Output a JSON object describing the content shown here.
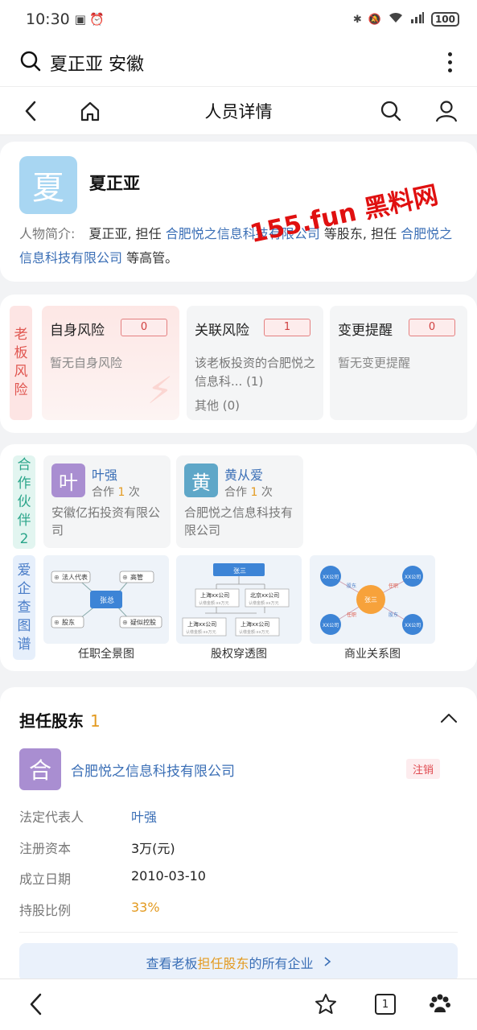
{
  "status": {
    "time": "10:30",
    "battery": "100"
  },
  "search": {
    "query": "夏正亚 安徽"
  },
  "nav": {
    "title": "人员详情"
  },
  "profile": {
    "avatar_char": "夏",
    "name": "夏正亚",
    "bio_label": "人物简介:",
    "bio_part1": "夏正亚, 担任",
    "bio_company1": "合肥悦之信息科技有限公司",
    "bio_part2": "等股东, 担任",
    "bio_company2": "合肥悦之信息科技有限公司",
    "bio_part3": "等高管。"
  },
  "watermark": "155.fun 黑料网",
  "risk": {
    "tag_chars": [
      "老",
      "板",
      "风",
      "险"
    ],
    "boxes": [
      {
        "title": "自身风险",
        "count": "0",
        "desc": "暂无自身风险"
      },
      {
        "title": "关联风险",
        "count": "1",
        "desc": "该老板投资的合肥悦之信息科... (1)",
        "extra": "其他 (0)"
      },
      {
        "title": "变更提醒",
        "count": "0",
        "desc": "暂无变更提醒"
      }
    ]
  },
  "partners": {
    "tag_chars": [
      "合",
      "作",
      "伙",
      "伴",
      "2"
    ],
    "items": [
      {
        "avatar_char": "叶",
        "name": "叶强",
        "coop_prefix": "合作",
        "coop_count": "1",
        "coop_suffix": "次",
        "company": "安徽亿拓投资有限公司",
        "color": "#a98ed1"
      },
      {
        "avatar_char": "黄",
        "name": "黄从爱",
        "coop_prefix": "合作",
        "coop_count": "1",
        "coop_suffix": "次",
        "company": "合肥悦之信息科技有限公司",
        "color": "#5fa7c8"
      }
    ]
  },
  "graphs": {
    "tag_chars": [
      "爱",
      "企",
      "查",
      "图",
      "谱"
    ],
    "items": [
      {
        "caption": "任职全景图",
        "center": "张总",
        "labels": [
          "法人代表",
          "高管",
          "股东",
          "疑似控股"
        ]
      },
      {
        "caption": "股权穿透图",
        "top": "张三",
        "labels": [
          "上海xx公司",
          "北京xx公司",
          "上海xx公司",
          "上海xx公司"
        ],
        "sub": "认缴金额:xx万元"
      },
      {
        "caption": "商业关系图",
        "center": "张三",
        "nodes": [
          "XX公司",
          "XX公司",
          "XX公司",
          "XX公司"
        ],
        "edges": [
          "股东",
          "任职",
          "任职",
          "股东"
        ]
      }
    ]
  },
  "holder": {
    "title": "担任股东",
    "count": "1",
    "company_char": "合",
    "company": "合肥悦之信息科技有限公司",
    "status_tag": "注销",
    "rows": [
      {
        "key": "法定代表人",
        "value": "叶强"
      },
      {
        "key": "注册资本",
        "value": "3万(元)"
      },
      {
        "key": "成立日期",
        "value": "2010-03-10"
      },
      {
        "key": "持股比例",
        "value": "33%"
      }
    ],
    "view_prefix": "查看老板",
    "view_highlight": "担任股东",
    "view_suffix": "的所有企业"
  },
  "bottom": {
    "tab_count": "1"
  },
  "colors": {
    "link": "#3b6fb6",
    "accent": "#e39a20",
    "risk": "#d04040"
  }
}
